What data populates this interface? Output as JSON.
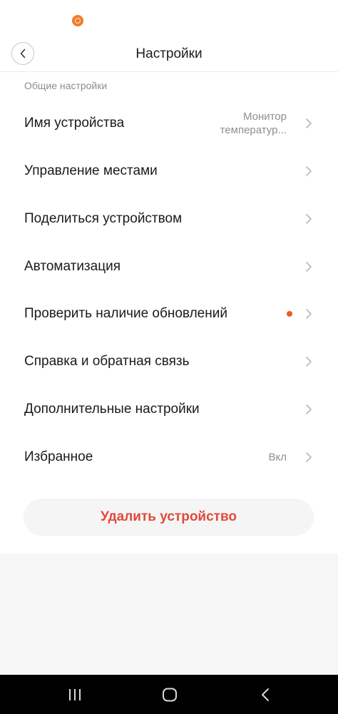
{
  "header": {
    "title": "Настройки"
  },
  "section": {
    "label": "Общие настройки"
  },
  "rows": [
    {
      "label": "Имя устройства",
      "value_line1": "Монитор",
      "value_line2": "температур..."
    },
    {
      "label": "Управление местами"
    },
    {
      "label": "Поделиться устройством"
    },
    {
      "label": "Автоматизация"
    },
    {
      "label": "Проверить наличие обновлений",
      "badge": "dot"
    },
    {
      "label": "Справка и обратная связь"
    },
    {
      "label": "Дополнительные настройки"
    },
    {
      "label": "Избранное",
      "value": "Вкл"
    }
  ],
  "delete_button": {
    "label": "Удалить устройство"
  },
  "colors": {
    "accent_red": "#e04a3b",
    "update_dot": "#f05a24",
    "status_icon": "#f07a2b"
  },
  "icons": {
    "status": "app-notification-icon",
    "back": "back-arrow-icon",
    "row_chevron": "chevron-right-icon",
    "nav_recents": "recents-icon",
    "nav_home": "home-icon",
    "nav_back": "nav-back-icon"
  }
}
